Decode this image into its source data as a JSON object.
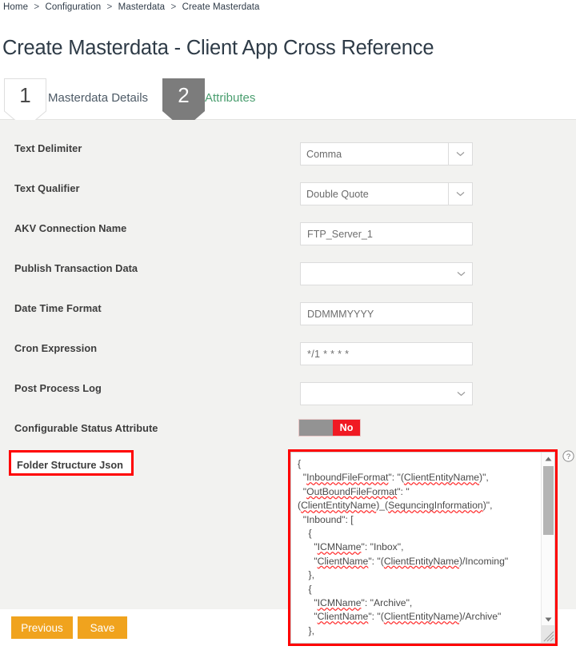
{
  "breadcrumb": {
    "items": [
      "Home",
      "Configuration",
      "Masterdata",
      "Create Masterdata"
    ],
    "separator": ">"
  },
  "page_title": "Create Masterdata - Client App Cross Reference",
  "tabs": [
    {
      "number": "1",
      "label": "Masterdata Details",
      "state": "inactive"
    },
    {
      "number": "2",
      "label": "Attributes",
      "state": "active"
    }
  ],
  "colors": {
    "active_step_fill": "#7c7c7c",
    "active_tab_label": "#4a9e6f",
    "primary_button": "#f0a31e",
    "toggle_off": "#f01a23",
    "highlight_box": "#ff0000",
    "panel_background": "#f2f2f0"
  },
  "form": {
    "fields": [
      {
        "label": "Text Delimiter",
        "type": "select-split",
        "value": "Comma",
        "placeholder": ""
      },
      {
        "label": "Text Qualifier",
        "type": "select-split",
        "value": "Double Quote",
        "placeholder": ""
      },
      {
        "label": "AKV Connection Name",
        "type": "text",
        "value": "FTP_Server_1",
        "placeholder": ""
      },
      {
        "label": "Publish Transaction Data",
        "type": "select-wide",
        "value": "",
        "placeholder": ""
      },
      {
        "label": "Date Time Format",
        "type": "text",
        "value": "DDMMMYYYY",
        "placeholder": ""
      },
      {
        "label": "Cron Expression",
        "type": "text",
        "value": "*/1 * * * *",
        "placeholder": ""
      },
      {
        "label": "Post Process Log",
        "type": "select-wide",
        "value": "",
        "placeholder": ""
      },
      {
        "label": "Configurable Status Attribute",
        "type": "toggle",
        "value": "No",
        "placeholder": ""
      }
    ],
    "json_field": {
      "label": "Folder Structure Json",
      "highlighted": true,
      "help_icon": "help-circle-icon",
      "value_lines": [
        "{",
        "  \"InboundFileFormat\": \"(ClientEntityName)\",",
        "  \"OutBoundFileFormat\": \"",
        "(ClientEntityName)_(SequncingInformation)\",",
        "  \"Inbound\": [",
        "    {",
        "      \"ICMName\": \"Inbox\",",
        "      \"ClientName\": \"(ClientEntityName)/Incoming\"",
        "    },",
        "    {",
        "      \"ICMName\": \"Archive\",",
        "      \"ClientName\": \"(ClientEntityName)/Archive\"",
        "    },"
      ]
    }
  },
  "footer": {
    "previous_label": "Previous",
    "save_label": "Save"
  }
}
